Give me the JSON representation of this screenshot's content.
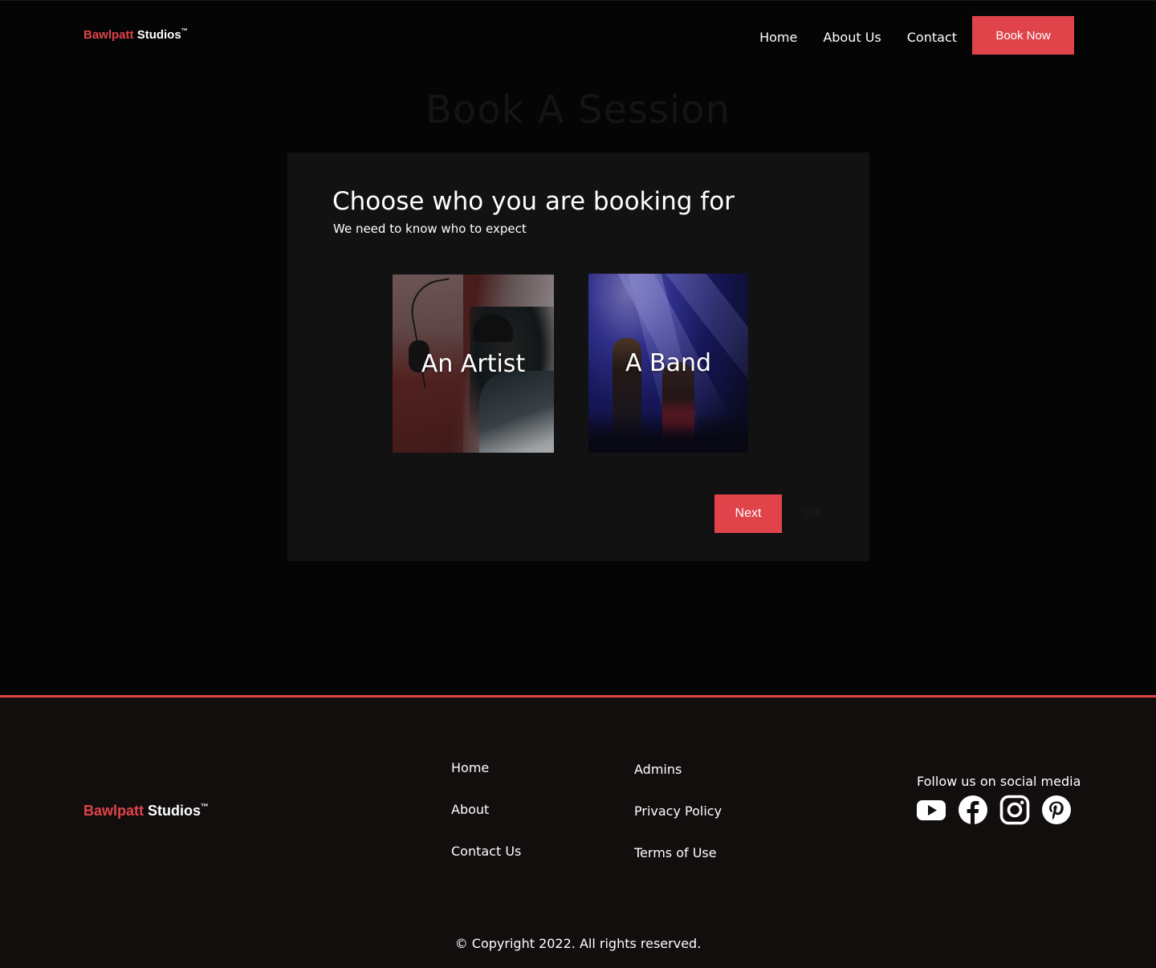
{
  "brand": {
    "name_red": "Bawlpatt",
    "name_white": "Studios",
    "tm": "™"
  },
  "nav": {
    "items": [
      {
        "label": "Home"
      },
      {
        "label": "About Us"
      },
      {
        "label": "Contact"
      }
    ],
    "cta_label": "Book Now"
  },
  "page": {
    "title": "Book A Session"
  },
  "booking": {
    "title": "Choose who you are booking for",
    "subtitle": "We need to know who to expect",
    "options": [
      {
        "label": "An Artist",
        "image": "artist-photo"
      },
      {
        "label": "A Band",
        "image": "band-photo"
      }
    ],
    "next_label": "Next",
    "step": "1/4"
  },
  "footer": {
    "links_col1": [
      {
        "label": "Home"
      },
      {
        "label": "About"
      },
      {
        "label": "Contact Us"
      }
    ],
    "links_col2": [
      {
        "label": "Admins"
      },
      {
        "label": "Privacy Policy"
      },
      {
        "label": "Terms of Use"
      }
    ],
    "social_label": "Follow us on social media",
    "social_icons": [
      "youtube-icon",
      "facebook-icon",
      "instagram-icon",
      "pinterest-icon"
    ],
    "copyright": "© Copyright 2022. All rights reserved."
  },
  "colors": {
    "accent": "#e0434a",
    "background": "#050505",
    "card": "#121212",
    "footer": "#120e0d"
  }
}
